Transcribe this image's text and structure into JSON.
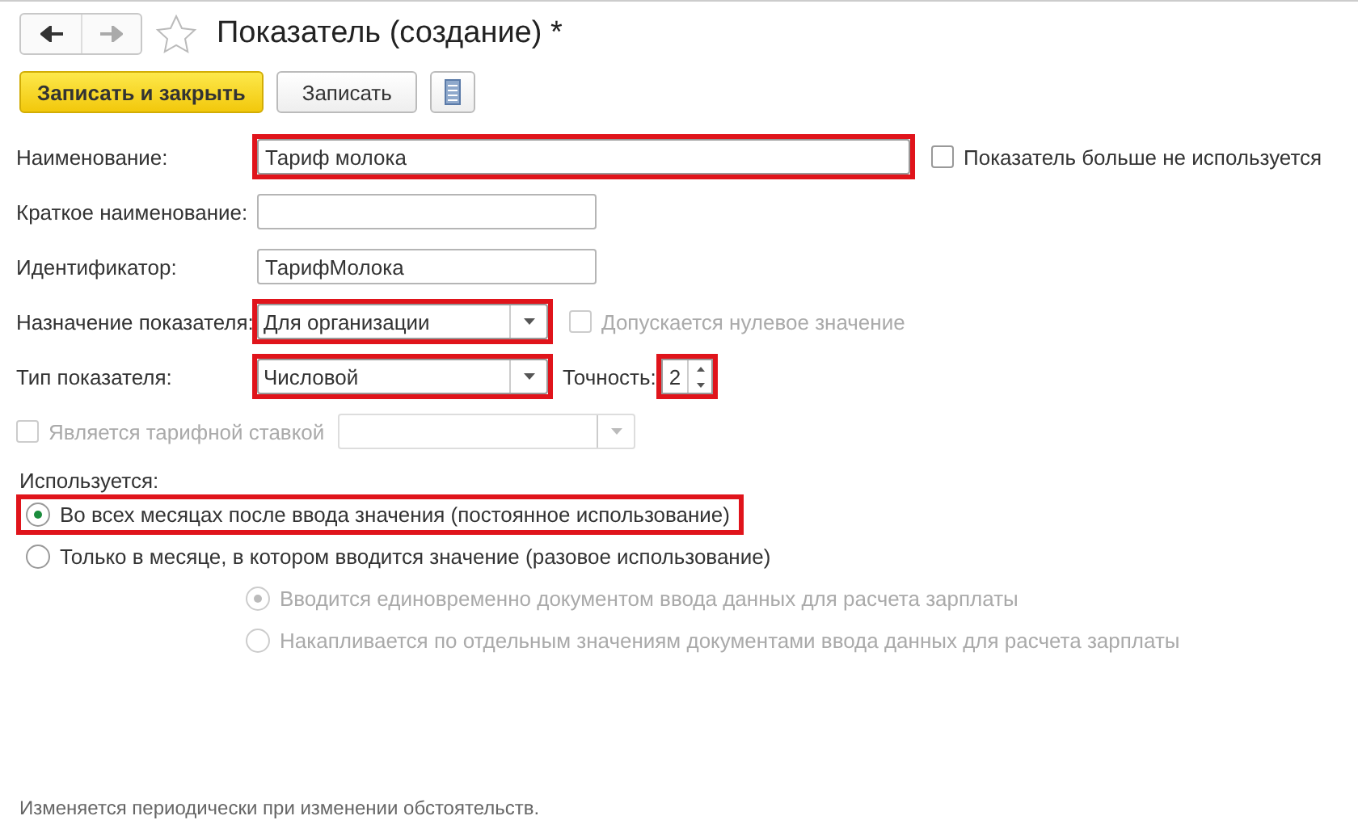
{
  "window": {
    "title": "Показатель (создание) *",
    "favorite": false
  },
  "toolbar": [
    {
      "kind": "primary",
      "label": "Записать и закрыть"
    },
    {
      "kind": "default",
      "label": "Записать"
    },
    {
      "kind": "icon"
    }
  ],
  "name": {
    "label": "Наименование:",
    "value": "Тариф молока",
    "highlighted": true
  },
  "not_used": {
    "label": "Показатель больше не используется",
    "checked": false,
    "disabled": false
  },
  "short_name": {
    "label": "Краткое наименование:"
  },
  "identifier": {
    "label": "Идентификатор:",
    "value": "ТарифМолока"
  },
  "purpose": {
    "label": "Назначение показателя:",
    "value": "Для организации",
    "highlighted": true
  },
  "zero_allowed": {
    "label": "Допускается нулевое значение",
    "checked": false,
    "disabled": true
  },
  "type": {
    "label": "Тип показателя:",
    "value": "Числовой",
    "highlighted": true
  },
  "precision": {
    "label": "Точность:",
    "value": "2",
    "highlighted": true
  },
  "tariff_rate": {
    "label": "Является тарифной ставкой",
    "checked": false,
    "disabled": true
  },
  "tariff_select": {
    "disabled": true
  },
  "usage": {
    "label": "Используется:",
    "options": [
      {
        "label": "Во всех месяцах после ввода значения (постоянное использование)",
        "selected": true,
        "disabled": false,
        "highlighted": true
      },
      {
        "label": "Только в месяце, в котором вводится значение (разовое использование)",
        "selected": false,
        "disabled": false,
        "children": [
          {
            "label": "Вводится единовременно документом ввода данных для расчета зарплаты",
            "selected": true,
            "disabled": true
          },
          {
            "label": "Накапливается по отдельным значениям документами ввода данных для расчета зарплаты",
            "selected": false,
            "disabled": true
          }
        ]
      }
    ]
  },
  "footer": "Изменяется периодически при изменении обстоятельств."
}
